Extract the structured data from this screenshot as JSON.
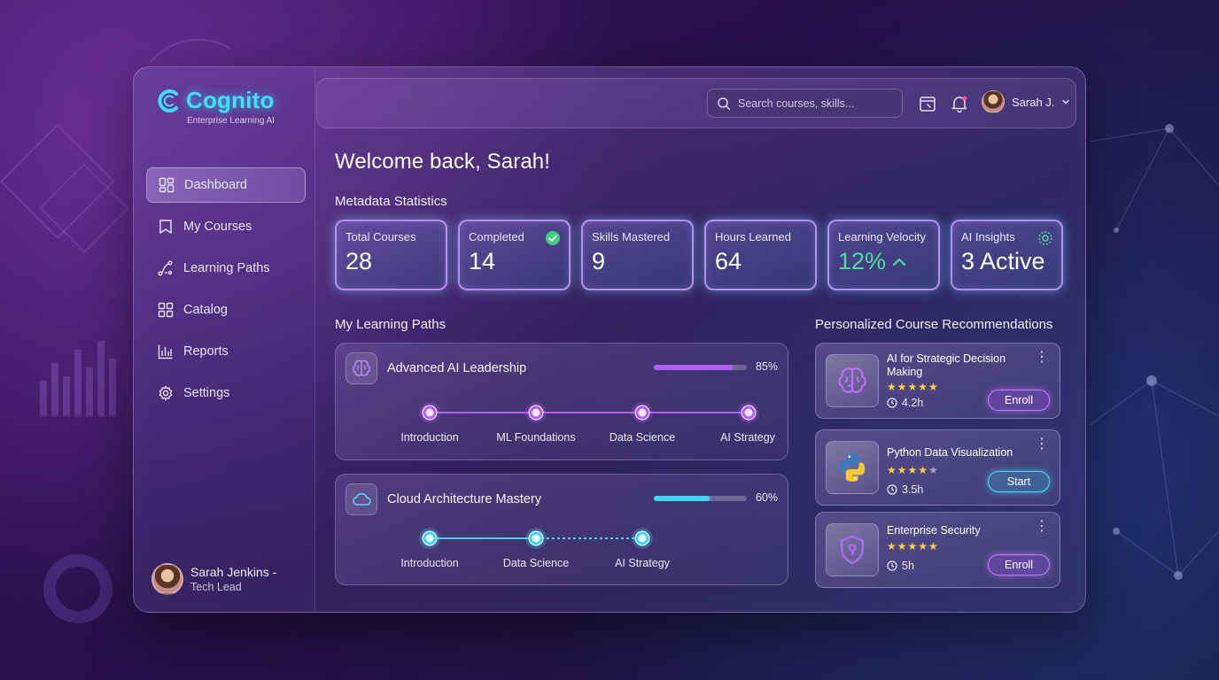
{
  "app": {
    "name": "Cognito",
    "tagline": "Enterprise Learning AI"
  },
  "sidebar": {
    "items": [
      {
        "label": "Dashboard",
        "icon": "dashboard-icon",
        "active": true
      },
      {
        "label": "My Courses",
        "icon": "bookmark-icon"
      },
      {
        "label": "Learning Paths",
        "icon": "route-icon"
      },
      {
        "label": "Catalog",
        "icon": "grid-icon"
      },
      {
        "label": "Reports",
        "icon": "bar-chart-icon"
      },
      {
        "label": "Settings",
        "icon": "gear-icon"
      }
    ],
    "profile": {
      "name": "Sarah Jenkins -",
      "role": "Tech Lead"
    }
  },
  "topbar": {
    "search_placeholder": "Search courses, skills...",
    "user_name": "Sarah J."
  },
  "main": {
    "welcome": "Welcome back, Sarah!",
    "stats_title": "Metadata Statistics",
    "stats": [
      {
        "label": "Total Courses",
        "value": "28"
      },
      {
        "label": "Completed",
        "value": "14"
      },
      {
        "label": "Skills Mastered",
        "value": "9"
      },
      {
        "label": "Hours Learned",
        "value": "64"
      },
      {
        "label": "Learning Velocity",
        "value": "12%"
      },
      {
        "label": "AI Insights",
        "value": "3 Active"
      }
    ],
    "paths_title": "My Learning Paths",
    "paths": [
      {
        "title": "Advanced AI Leadership",
        "percent_label": "85%",
        "progress": 0.85,
        "color": "#b45cff",
        "steps": [
          "Introduction",
          "ML Foundations",
          "Data Science",
          "AI Strategy"
        ]
      },
      {
        "title": "Cloud Architecture Mastery",
        "percent_label": "60%",
        "progress": 0.6,
        "color": "#3fd6f5",
        "steps": [
          "Introduction",
          "Data Science",
          "AI Strategy"
        ]
      }
    ],
    "recs_title": "Personalized Course Recommendations",
    "recs": [
      {
        "title": "AI for Strategic Decision Making",
        "rating": 5,
        "duration": "4.2h",
        "action": "Enroll",
        "icon": "brain-icon"
      },
      {
        "title": "Python Data Visualization",
        "rating": 4,
        "duration": "3.5h",
        "action": "Start",
        "icon": "python-icon"
      },
      {
        "title": "Enterprise Security",
        "rating": 5,
        "duration": "5h",
        "action": "Enroll",
        "icon": "shield-lock-icon"
      }
    ]
  },
  "colors": {
    "accent_cyan": "#3ee0ff",
    "accent_purple": "#b45cff",
    "success_green": "#4ee09a",
    "star_gold": "#ffd23e"
  }
}
